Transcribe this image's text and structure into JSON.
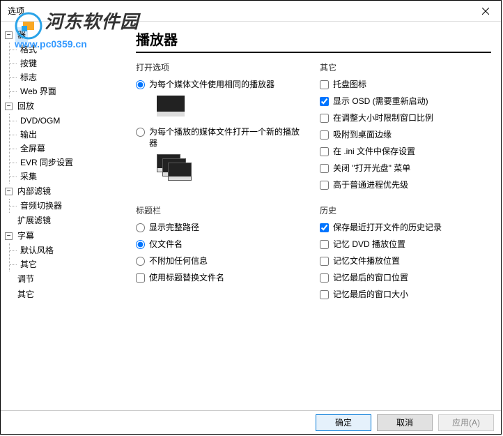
{
  "window": {
    "title": "选项"
  },
  "watermark": {
    "text": "河东软件园",
    "url": "www.pc0359.cn"
  },
  "sidebar": {
    "groups": [
      {
        "name": "器",
        "expanded": true,
        "children": [
          "格式",
          "按键",
          "标志",
          "Web 界面"
        ]
      },
      {
        "name": "回放",
        "expanded": true,
        "children": [
          "DVD/OGM",
          "输出",
          "全屏幕",
          "EVR 同步设置",
          "采集"
        ]
      },
      {
        "name": "内部滤镜",
        "expanded": true,
        "children": [
          "音频切换器"
        ]
      },
      {
        "name": "扩展滤镜",
        "expanded": false,
        "children": []
      },
      {
        "name": "字幕",
        "expanded": true,
        "children": [
          "默认风格",
          "其它"
        ]
      },
      {
        "name": "调节",
        "expanded": false,
        "children": []
      },
      {
        "name": "其它",
        "expanded": false,
        "children": []
      }
    ]
  },
  "page": {
    "title": "播放器"
  },
  "groups": {
    "openOptions": {
      "title": "打开选项",
      "radio1": "为每个媒体文件使用相同的播放器",
      "radio2": "为每个播放的媒体文件打开一个新的播放器"
    },
    "other": {
      "title": "其它",
      "items": [
        {
          "label": "托盘图标",
          "checked": false
        },
        {
          "label": "显示 OSD (需要重新启动)",
          "checked": true
        },
        {
          "label": "在调整大小时限制窗口比例",
          "checked": false
        },
        {
          "label": "吸附到桌面边缘",
          "checked": false
        },
        {
          "label": "在 .ini 文件中保存设置",
          "checked": false
        },
        {
          "label": "关闭 \"打开光盘\" 菜单",
          "checked": false
        },
        {
          "label": "高于普通进程优先级",
          "checked": false
        }
      ]
    },
    "titlebar": {
      "title": "标题栏",
      "radios": [
        {
          "label": "显示完整路径",
          "checked": false
        },
        {
          "label": "仅文件名",
          "checked": true
        },
        {
          "label": "不附加任何信息",
          "checked": false
        }
      ],
      "checkbox": {
        "label": "使用标题替换文件名",
        "checked": false
      }
    },
    "history": {
      "title": "历史",
      "items": [
        {
          "label": "保存最近打开文件的历史记录",
          "checked": true
        },
        {
          "label": "记忆 DVD 播放位置",
          "checked": false
        },
        {
          "label": "记忆文件播放位置",
          "checked": false
        },
        {
          "label": "记忆最后的窗口位置",
          "checked": false
        },
        {
          "label": "记忆最后的窗口大小",
          "checked": false
        }
      ]
    }
  },
  "buttons": {
    "ok": "确定",
    "cancel": "取消",
    "apply": "应用(A)"
  }
}
